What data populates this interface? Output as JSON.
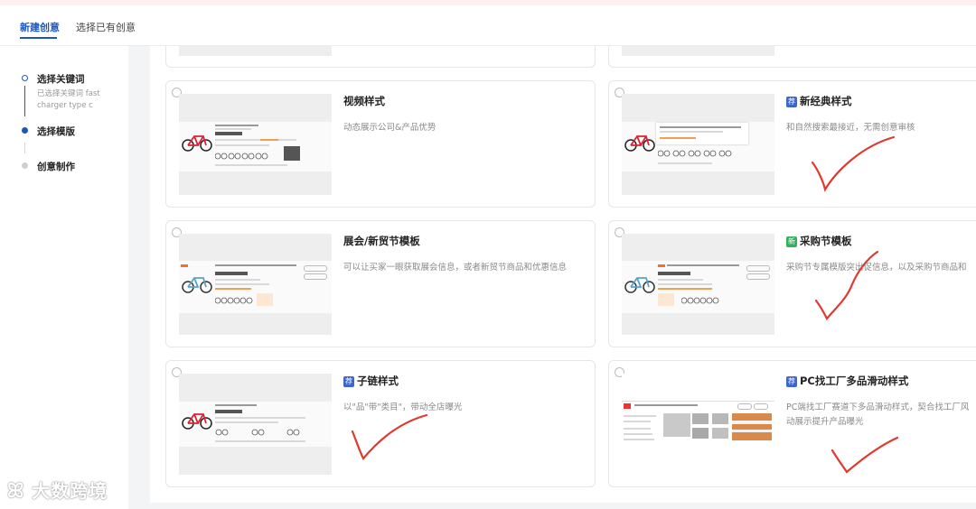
{
  "tabs": {
    "new_creative": "新建创意",
    "existing_creative": "选择已有创意"
  },
  "steps": [
    {
      "title": "选择关键词",
      "sub": "已选择关键词 fast charger type c",
      "state": "done"
    },
    {
      "title": "选择模版",
      "state": "current"
    },
    {
      "title": "创意制作",
      "state": "pending"
    }
  ],
  "cards": [
    {
      "title": "视频样式",
      "badge": "",
      "desc": "动态展示公司&产品优势"
    },
    {
      "title": "新经典样式",
      "badge": "荐",
      "desc": "和自然搜索最接近，无需创意审核"
    },
    {
      "title": "展会/新贸节模板",
      "badge": "",
      "desc": "可以让买家一眼获取展会信息，或者新贸节商品和优惠信息"
    },
    {
      "title": "采购节模板",
      "badge": "新",
      "desc": "采购节专属模版突出促信息，以及采购节商品和"
    },
    {
      "title": "子链样式",
      "badge": "荐",
      "desc": "以\"品\"带\"类目\"，带动全店曝光"
    },
    {
      "title": "PC找工厂多品滑动样式",
      "badge": "荐",
      "desc": "PC端找工厂赛道下多品滑动样式，契合找工厂风",
      "desc2": "动展示提升产品曝光"
    }
  ],
  "colors": {
    "accent": "#1a55c4",
    "badge_blue": "#3f67c9",
    "badge_green": "#2fb35b",
    "check_red": "#e0392f"
  },
  "watermark": "大数跨境"
}
